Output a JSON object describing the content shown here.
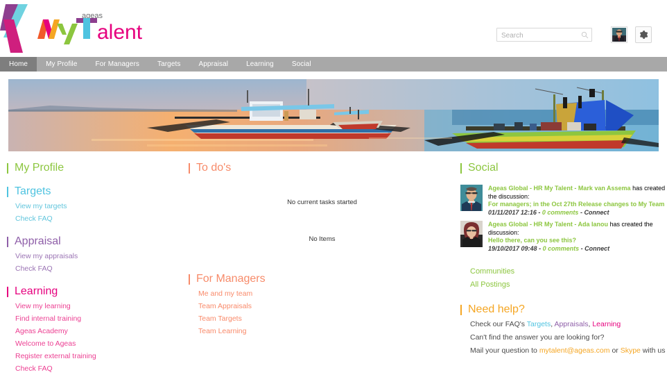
{
  "brand": {
    "name": "ageas",
    "product_my": "My",
    "product_talent": "Talent",
    "colors": {
      "green": "#8cc63f",
      "cyan": "#4ec3e0",
      "purple": "#8e5ea8",
      "pink": "#e6007e",
      "orange": "#f78b6a",
      "amber": "#f5a623",
      "magenta": "#cf1f7e"
    }
  },
  "header": {
    "search": {
      "placeholder": "Search",
      "value": "",
      "icon": "search-icon"
    },
    "avatar_alt": "user-avatar",
    "settings_icon": "gear-icon"
  },
  "nav": {
    "items": [
      {
        "label": "Home",
        "active": true
      },
      {
        "label": "My Profile",
        "active": false
      },
      {
        "label": "For Managers",
        "active": false
      },
      {
        "label": "Targets",
        "active": false
      },
      {
        "label": "Appraisal",
        "active": false
      },
      {
        "label": "Learning",
        "active": false
      },
      {
        "label": "Social",
        "active": false
      }
    ]
  },
  "banner": {
    "alt": "Sunset beach with outrigger boats banner"
  },
  "left": {
    "my_profile": {
      "title": "My Profile",
      "color": "#8cc63f"
    },
    "targets": {
      "title": "Targets",
      "color": "#4ec3e0",
      "links": [
        "View my targets",
        "Check FAQ"
      ]
    },
    "appraisal": {
      "title": "Appraisal",
      "color": "#8e5ea8",
      "links": [
        "View my appraisals",
        "Check FAQ"
      ]
    },
    "learning": {
      "title": "Learning",
      "color": "#e6007e",
      "links": [
        "View my learning",
        "Find internal training",
        "Ageas Academy",
        "Welcome to Ageas",
        "Register external training",
        "Check FAQ"
      ]
    }
  },
  "middle": {
    "todos": {
      "title": "To do's",
      "color": "#f78b6a",
      "empty_tasks": "No current tasks started",
      "empty_items": "No Items"
    },
    "for_managers": {
      "title": "For Managers",
      "color": "#f78b6a",
      "links": [
        "Me and my team",
        "Team Appraisals",
        "Team Targets",
        "Team Learning"
      ]
    }
  },
  "right": {
    "social": {
      "title": "Social",
      "color": "#8cc63f",
      "posts": [
        {
          "author_line": "Ageas Global - HR My Talent - Mark van Assema",
          "action": " has created the discussion:",
          "subject": "For managers; in the Oct 27th Release changes to My Team",
          "timestamp": "01/11/2017 12:16",
          "comments": "0 comments",
          "connect": "Connect"
        },
        {
          "author_line": "Ageas Global - HR My Talent - Ada Ianou",
          "action": " has created the discussion:",
          "subject": "Hello there, can you see this?",
          "timestamp": "19/10/2017 09:48",
          "comments": "0 comments",
          "connect": "Connect"
        }
      ],
      "links": [
        "Communities",
        "All Postings"
      ]
    },
    "need_help": {
      "title": "Need help?",
      "color": "#f5a623",
      "line1_prefix": "Check our FAQ's ",
      "faq_links": [
        {
          "label": "Targets",
          "color": "#4ec3e0"
        },
        {
          "label": "Appraisals",
          "color": "#8e5ea8"
        },
        {
          "label": "Learning",
          "color": "#e6007e"
        }
      ],
      "line2": "Can't find the answer you are looking for?",
      "line3_prefix": "Mail your question to ",
      "email": "mytalent@ageas.com",
      "line3_mid": " or ",
      "skype": "Skype",
      "line3_suffix": " with us"
    }
  }
}
